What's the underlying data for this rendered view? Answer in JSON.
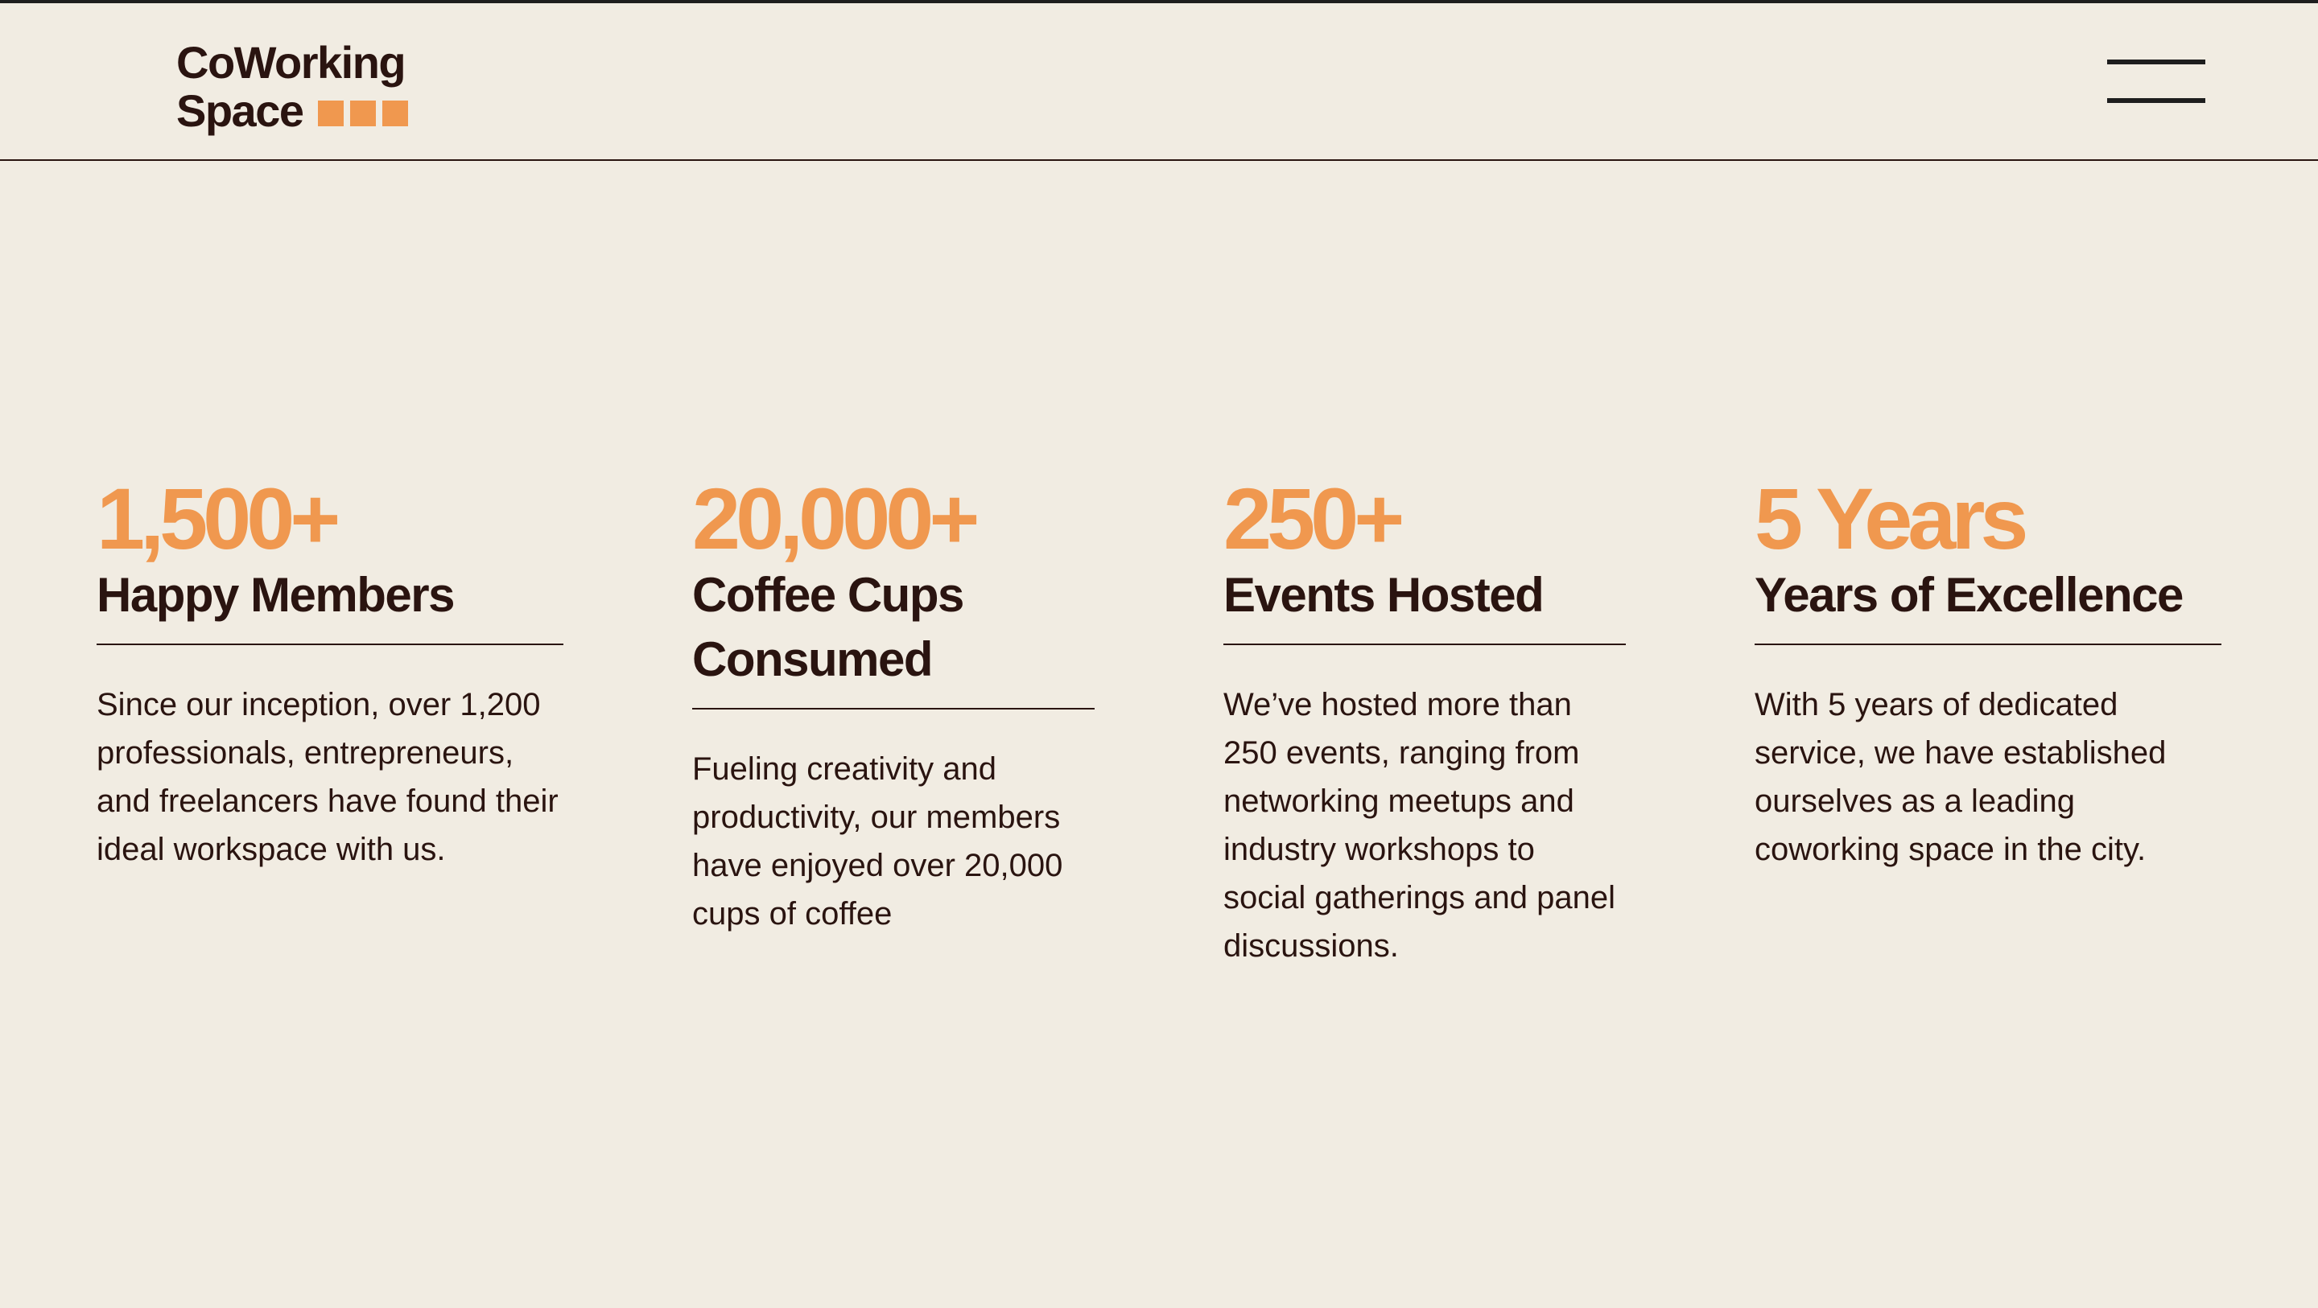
{
  "logo": {
    "line1": "CoWorking",
    "line2": "Space"
  },
  "header": {
    "menu_icon": "hamburger-menu-icon"
  },
  "colors": {
    "background": "#F1ECE2",
    "accent": "#F0984F",
    "text": "#2A1410"
  },
  "stats": [
    {
      "number": "1,500+",
      "title": "Happy Members",
      "description": "Since our inception, over 1,200 professionals, entrepreneurs, and freelancers have found their ideal workspace with us."
    },
    {
      "number": "20,000+",
      "title": "Coffee Cups Consumed",
      "description": "Fueling creativity and productivity, our members have enjoyed over 20,000 cups of coffee"
    },
    {
      "number": "250+",
      "title": "Events Hosted",
      "description": "We’ve hosted more than 250 events, ranging from networking meetups and industry workshops to social gatherings and panel discussions."
    },
    {
      "number": "5 Years",
      "title": "Years of Excellence",
      "description": "With 5 years of dedicated service, we have established ourselves as a leading coworking space in the city."
    }
  ]
}
